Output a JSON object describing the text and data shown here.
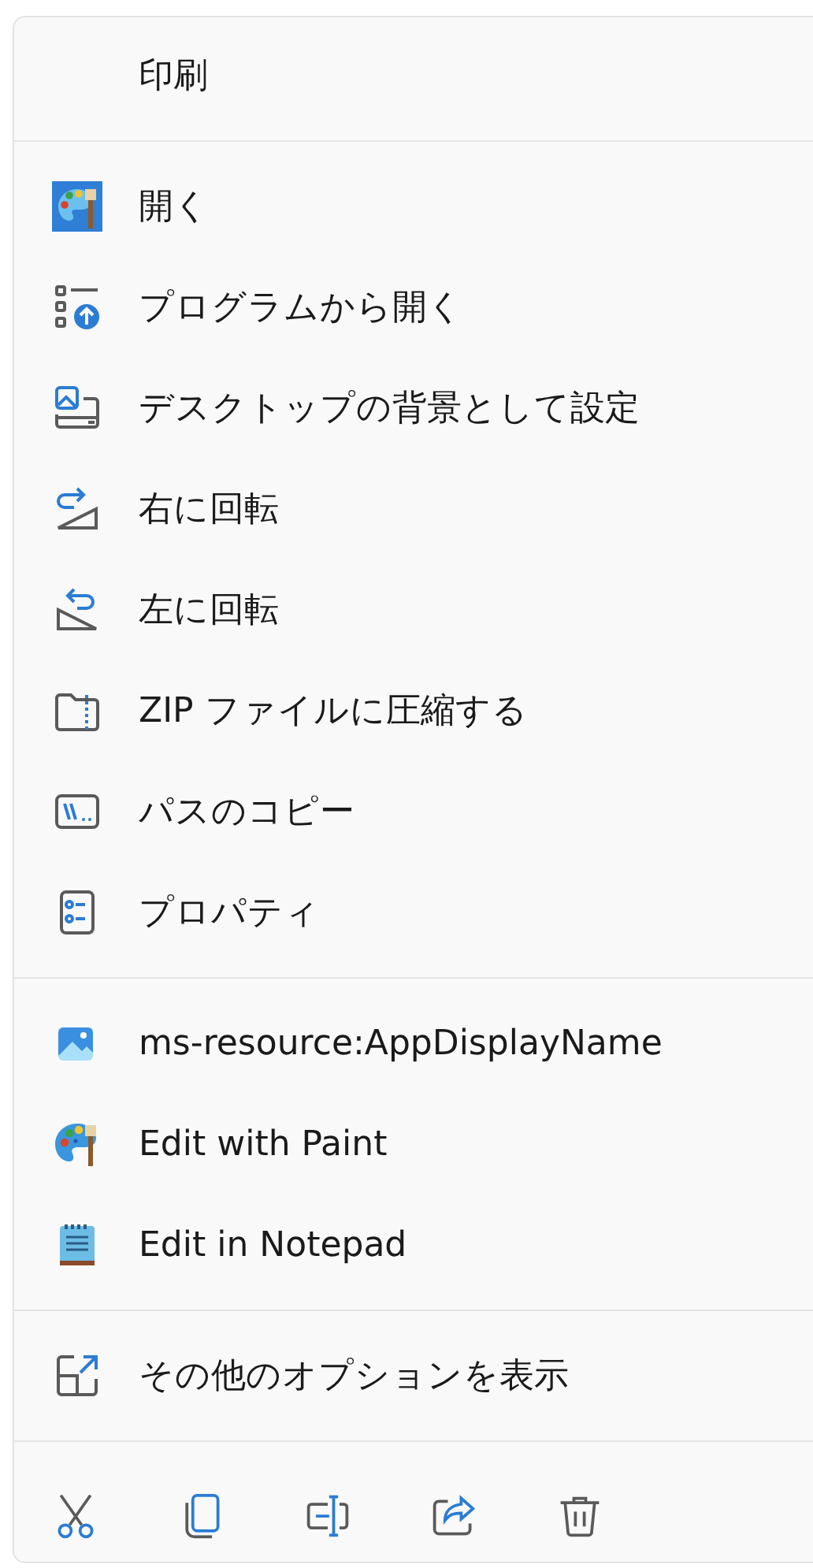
{
  "menu": {
    "groups": [
      {
        "items": [
          {
            "label": "印刷"
          }
        ]
      },
      {
        "items": [
          {
            "label": "開く"
          },
          {
            "label": "プログラムから開く"
          },
          {
            "label": "デスクトップの背景として設定"
          },
          {
            "label": "右に回転"
          },
          {
            "label": "左に回転"
          },
          {
            "label": "ZIP ファイルに圧縮する"
          },
          {
            "label": "パスのコピー"
          },
          {
            "label": "プロパティ"
          }
        ]
      },
      {
        "items": [
          {
            "label": "ms-resource:AppDisplayName"
          },
          {
            "label": "Edit with Paint"
          },
          {
            "label": "Edit in Notepad"
          }
        ]
      },
      {
        "items": [
          {
            "label": "その他のオプションを表示"
          }
        ]
      }
    ]
  }
}
